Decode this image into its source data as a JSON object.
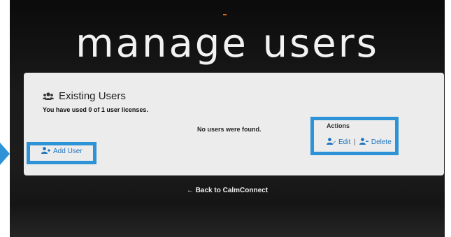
{
  "page": {
    "title": "manage users",
    "back_link": "← Back to CalmConnect"
  },
  "panel": {
    "heading": "Existing Users",
    "license_text": "You have used 0 of 1 user licenses.",
    "empty_text": "No users were found.",
    "actions_title": "Actions",
    "edit_label": "Edit",
    "separator": "|",
    "delete_label": "Delete",
    "add_user_label": "Add User"
  },
  "colors": {
    "highlight": "#2e93d6",
    "link": "#1e73be",
    "panel_bg": "#ececec"
  },
  "icons": {
    "heading": "users-group-icon",
    "add_user": "user-plus-icon",
    "edit": "user-edit-icon",
    "delete": "user-minus-icon"
  }
}
